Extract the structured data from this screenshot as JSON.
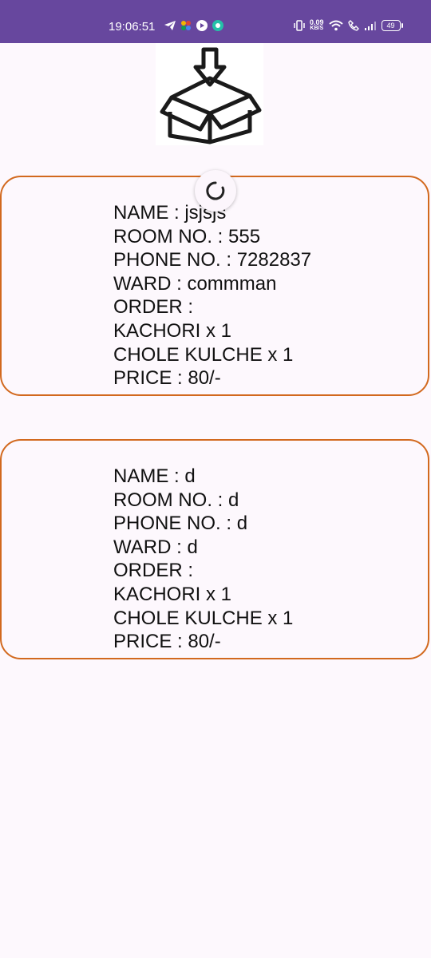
{
  "status_bar": {
    "time": "19:06:51",
    "network_speed_value": "0.09",
    "network_speed_unit": "KB/S",
    "battery": "49",
    "icons": [
      "telegram-icon",
      "pinwheel-app-icon",
      "play-icon",
      "chat-icon",
      "vibrate-icon",
      "wifi-icon",
      "call-icon",
      "signal-icon",
      "battery-icon"
    ]
  },
  "header": {
    "logo_icon": "box-download-icon"
  },
  "refresh": {
    "icon": "refresh-spinner-icon"
  },
  "orders": [
    {
      "name_line": "NAME : jsjsjs",
      "room_line": "ROOM NO. : 555",
      "phone_line": "PHONE NO. : 7282837",
      "ward_line": "WARD : commman",
      "order_label": "ORDER :",
      "items": [
        "KACHORI x 1",
        "CHOLE KULCHE x 1"
      ],
      "price_line": "PRICE : 80/-"
    },
    {
      "name_line": "NAME : d",
      "room_line": "ROOM NO. : d",
      "phone_line": "PHONE NO. : d",
      "ward_line": "WARD : d",
      "order_label": "ORDER :",
      "items": [
        "KACHORI x 1",
        "CHOLE KULCHE x 1"
      ],
      "price_line": "PRICE : 80/-"
    }
  ],
  "colors": {
    "status_bar": "#67479e",
    "background": "#fdf8fd",
    "card_border": "#d2691e",
    "text": "#111111"
  }
}
